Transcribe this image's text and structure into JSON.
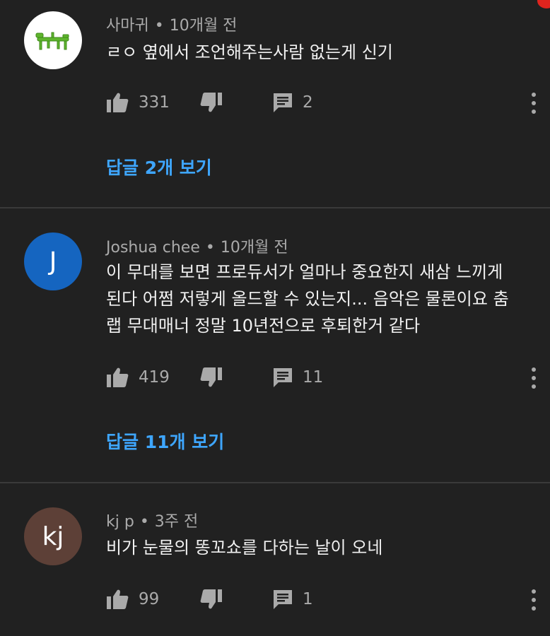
{
  "colors": {
    "background": "#212121",
    "divider": "#3a3a3a",
    "link_blue": "#3ea6ff",
    "meta_gray": "#aaaaaa",
    "text": "#f1f1f1",
    "notification_red": "#e0241e"
  },
  "comments": [
    {
      "author": "사마귀",
      "separator": "•",
      "time": "10개월 전",
      "avatar": {
        "type": "image",
        "icon": "mantis-icon",
        "bg": "#ffffff"
      },
      "text_lines": [
        "ㄹㅇ 옆에서 조언해주는사람 없는게 신기"
      ],
      "likes": "331",
      "replies_count": "2",
      "view_replies": "답글 2개 보기"
    },
    {
      "author": "Joshua chee",
      "separator": "•",
      "time": "10개월 전",
      "avatar": {
        "type": "letter",
        "letter": "J",
        "bg": "#1565c0"
      },
      "text_lines": [
        "이 무대를 보면 프로듀서가 얼마나 중요한지 새삼 느끼게",
        "된다 어쩜 저렇게 올드할 수 있는지...  음악은 물론이요 춤",
        "랩 무대매너 정말 10년전으로 후퇴한거 같다"
      ],
      "likes": "419",
      "replies_count": "11",
      "view_replies": "답글 11개 보기"
    },
    {
      "author": "kj p",
      "separator": "•",
      "time": "3주 전",
      "avatar": {
        "type": "letter",
        "letter": "kj",
        "bg": "#5d4037"
      },
      "text_lines": [
        "비가 눈물의 똥꼬쇼를 다하는 날이 오네"
      ],
      "likes": "99",
      "replies_count": "1"
    }
  ]
}
